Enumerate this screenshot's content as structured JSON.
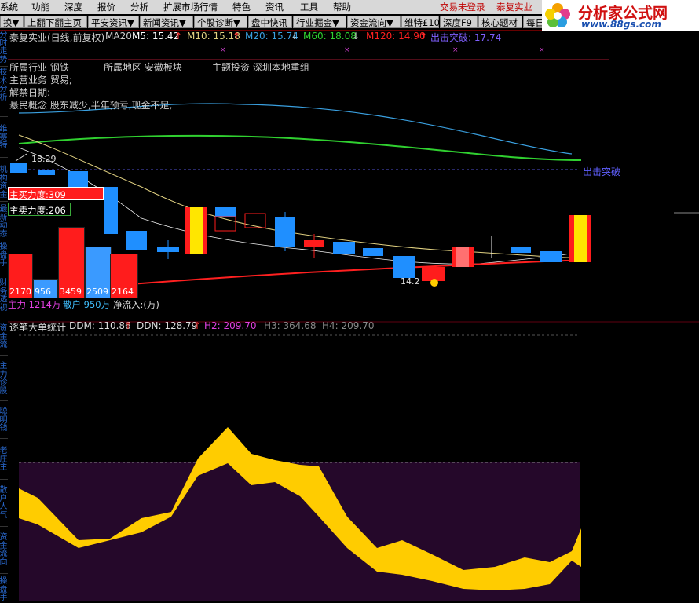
{
  "menubar": {
    "items": [
      "系统",
      "功能",
      "深度",
      "报价",
      "分析",
      "扩展市场行情",
      "特色",
      "资讯",
      "工具",
      "帮助"
    ],
    "login_status": "交易未登录",
    "stock_name": "泰复实业"
  },
  "toolbar": {
    "items": [
      "换▼",
      "上翻下翻主页",
      "平安资讯▼",
      "新闻资讯▼",
      "个股诊断▼",
      "盘中快讯",
      "行业掘金▼",
      "资金流向▼",
      "维特£10",
      "深度F9",
      "核心题材",
      "每日"
    ]
  },
  "logo": {
    "title": "分析家公式网",
    "url": "www.88gs.com"
  },
  "sidebar": {
    "labels": [
      "分时走势",
      "技术分析",
      "维赛特",
      "机构资金",
      "最新动态",
      "操盘手",
      "财务透视",
      "资金流",
      "主力诊股",
      "聪明钱",
      "老庄主",
      "散户人气",
      "资金流向",
      "操盘手"
    ]
  },
  "main_header": {
    "title": "泰复实业(日线,前复权)",
    "ma20": "MA20",
    "m5": "M5: 15.42",
    "m10": "M10: 15.18",
    "m20": "M20: 15.74",
    "m60": "M60: 18.08",
    "m120": "M120: 14.90",
    "breakout": "出击突破: 17.74"
  },
  "stock_info": {
    "industry": "所属行业 钢铁",
    "region": "所属地区 安徽板块",
    "theme": "主题投资 深圳本地重组",
    "business": "主营业务 贸易;",
    "unlock": "解禁日期:",
    "concept": "悬民概念 股东减少,半年预亏,现金不足,"
  },
  "annotations": {
    "high": "18.29",
    "low": "14.2",
    "breakout_label": "出击突破"
  },
  "force_panel": {
    "buy_label": "主买力度:309",
    "sell_label": "主卖力度:206",
    "bars": [
      {
        "value": "2170",
        "color": "#ff1c1c",
        "level": 0.34
      },
      {
        "value": "956",
        "color": "#3a9aff",
        "level": 0.15
      },
      {
        "value": "3459",
        "color": "#ff1c1c",
        "level": 0.54
      },
      {
        "value": "2509",
        "color": "#3a9aff",
        "level": 0.39
      },
      {
        "value": "2164",
        "color": "#ff1c1c",
        "level": 0.34
      }
    ],
    "main_force": "主力 1214万",
    "retail": "散户 950万",
    "net_flow": "净流入:(万)"
  },
  "lower_header": {
    "title": "逐笔大单统计",
    "ddm": "DDM: 110.86",
    "ddn": "DDN: 128.79",
    "h2": "H2: 209.70",
    "h3": "H3: 364.68",
    "h4": "H4: 209.70"
  },
  "colors": {
    "up": "#ff1c1c",
    "down": "#1f8fff",
    "ma5": "#ffffff",
    "ma10": "#e0d080",
    "ma20": "#40a0e0",
    "ma60": "#30d030",
    "ma120": "#ff2020",
    "ddm_fill": "#ffcc00",
    "band_fill": "#25082a",
    "label_blue": "#2a6ad0"
  }
}
